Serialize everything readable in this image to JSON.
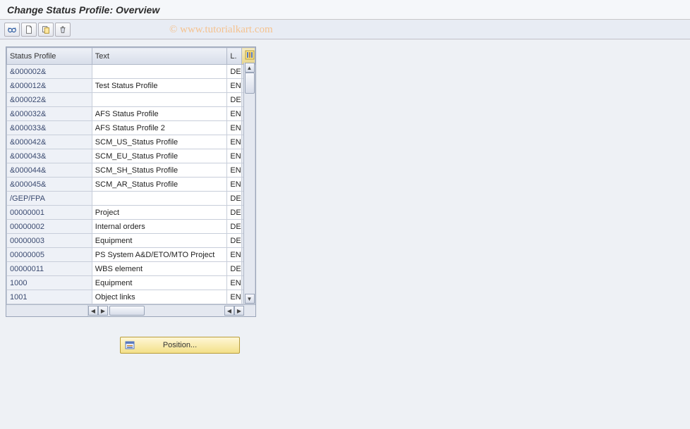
{
  "title": "Change Status Profile: Overview",
  "watermark": "© www.tutorialkart.com",
  "toolbar": {
    "details_tooltip": "Details",
    "new_tooltip": "New Entries",
    "copy_tooltip": "Copy As",
    "delete_tooltip": "Delete"
  },
  "table": {
    "headers": {
      "profile": "Status Profile",
      "text": "Text",
      "lang": "L."
    },
    "rows": [
      {
        "profile": "&000002&",
        "text": "",
        "lang": "DE"
      },
      {
        "profile": "&000012&",
        "text": "Test Status Profile",
        "lang": "EN"
      },
      {
        "profile": "&000022&",
        "text": "",
        "lang": "DE"
      },
      {
        "profile": "&000032&",
        "text": "AFS Status Profile",
        "lang": "EN"
      },
      {
        "profile": "&000033&",
        "text": "AFS Status Profile 2",
        "lang": "EN"
      },
      {
        "profile": "&000042&",
        "text": "SCM_US_Status Profile",
        "lang": "EN"
      },
      {
        "profile": "&000043&",
        "text": "SCM_EU_Status Profile",
        "lang": "EN"
      },
      {
        "profile": "&000044&",
        "text": "SCM_SH_Status Profile",
        "lang": "EN"
      },
      {
        "profile": "&000045&",
        "text": "SCM_AR_Status Profile",
        "lang": "EN"
      },
      {
        "profile": "/GEP/FPA",
        "text": "",
        "lang": "DE"
      },
      {
        "profile": "00000001",
        "text": "Project",
        "lang": "DE"
      },
      {
        "profile": "00000002",
        "text": "Internal orders",
        "lang": "DE"
      },
      {
        "profile": "00000003",
        "text": "Equipment",
        "lang": "DE"
      },
      {
        "profile": "00000005",
        "text": "PS System A&D/ETO/MTO Project",
        "lang": "EN"
      },
      {
        "profile": "00000011",
        "text": "WBS element",
        "lang": "DE"
      },
      {
        "profile": "1000",
        "text": "Equipment",
        "lang": "EN"
      },
      {
        "profile": "1001",
        "text": "Object links",
        "lang": "EN"
      }
    ]
  },
  "position_button": {
    "label": "Position..."
  }
}
